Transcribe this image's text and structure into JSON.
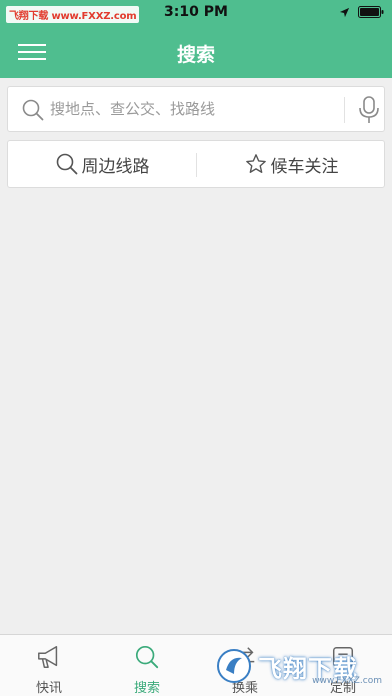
{
  "status_bar": {
    "left_text": "飞翔下载 www.FXXZ.com",
    "time": "3:10 PM"
  },
  "nav": {
    "title": "搜索"
  },
  "search": {
    "placeholder": "搜地点、查公交、找路线"
  },
  "tabs": [
    {
      "label": "周边线路",
      "icon": "search-icon"
    },
    {
      "label": "候车关注",
      "icon": "star-icon"
    }
  ],
  "bottom_nav": {
    "items": [
      {
        "label": "快讯",
        "icon": "megaphone-icon"
      },
      {
        "label": "搜索",
        "icon": "search-icon",
        "active": true
      },
      {
        "label": "换乘",
        "icon": "transfer-icon"
      },
      {
        "label": "定制",
        "icon": "custom-icon"
      }
    ]
  },
  "watermark": {
    "text": "飞翔下载",
    "url": "www.FXXZ.com"
  },
  "colors": {
    "accent": "#4fbe8f",
    "active_tab": "#3aaa7a",
    "background": "#efefef"
  }
}
